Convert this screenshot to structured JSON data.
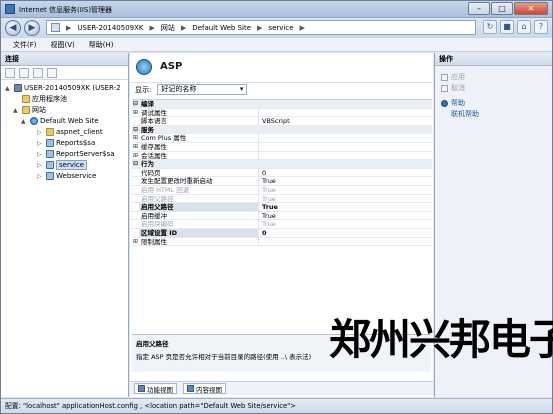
{
  "window": {
    "title": "Internet 信息服务(IIS)管理器"
  },
  "address": {
    "segments": [
      "USER-20140509XK",
      "网站",
      "Default Web Site",
      "service"
    ],
    "separator": "▶"
  },
  "menu": [
    "文件(F)",
    "视图(V)",
    "帮助(H)"
  ],
  "connections": {
    "header": "连接",
    "tree": [
      {
        "label": "USER-20140509XK (USER-2",
        "icon": "server-icon",
        "toggle": "▲"
      },
      {
        "label": "应用程序池",
        "icon": "folder-icon",
        "toggle": ""
      },
      {
        "label": "网站",
        "icon": "folder-icon",
        "toggle": "▲"
      },
      {
        "label": "Default Web Site",
        "icon": "globe-icon",
        "toggle": "▲"
      },
      {
        "label": "aspnet_client",
        "icon": "folder-icon",
        "toggle": "▷"
      },
      {
        "label": "Reports$sa",
        "icon": "app-icon",
        "toggle": "▷"
      },
      {
        "label": "ReportServer$sa",
        "icon": "app-icon",
        "toggle": "▷"
      },
      {
        "label": "service",
        "icon": "app-icon",
        "toggle": "▷",
        "selected": true
      },
      {
        "label": "Webservice",
        "icon": "app-icon",
        "toggle": "▷"
      }
    ]
  },
  "center": {
    "title": "ASP",
    "show_label": "显示:",
    "show_value": "好记的名称",
    "rows": [
      {
        "type": "cat",
        "name": "编译",
        "exp": "⊟"
      },
      {
        "type": "row",
        "name": "调试属性",
        "value": "",
        "exp": "⊞"
      },
      {
        "type": "row",
        "name": "脚本语言",
        "value": "VBScript",
        "exp": ""
      },
      {
        "type": "cat",
        "name": "服务",
        "exp": "⊟"
      },
      {
        "type": "row",
        "name": "Com Plus 属性",
        "value": "",
        "exp": "⊞"
      },
      {
        "type": "row",
        "name": "缓存属性",
        "value": "",
        "exp": "⊞"
      },
      {
        "type": "row",
        "name": "会话属性",
        "value": "",
        "exp": "⊞"
      },
      {
        "type": "cat",
        "name": "行为",
        "exp": "⊟"
      },
      {
        "type": "row",
        "name": "代码页",
        "value": "0",
        "exp": ""
      },
      {
        "type": "row",
        "name": "发生配置更改时重新启动",
        "value": "True",
        "exp": ""
      },
      {
        "type": "dim",
        "name": "启用 HTML 回退",
        "value": "True",
        "exp": ""
      },
      {
        "type": "dim",
        "name": "启用父路径",
        "value": "True",
        "exp": ""
      },
      {
        "type": "bold",
        "name": "启用父路径",
        "value": "True",
        "exp": ""
      },
      {
        "type": "row",
        "name": "启用缓冲",
        "value": "True",
        "exp": ""
      },
      {
        "type": "dim",
        "name": "启用块编码",
        "value": "True",
        "exp": ""
      },
      {
        "type": "bold",
        "name": "区域设置 ID",
        "value": "0",
        "exp": ""
      },
      {
        "type": "row",
        "name": "限制属性",
        "value": "",
        "exp": "⊞"
      }
    ],
    "description_title": "启用父路径",
    "description_text": "指定 ASP 页是否允许相对于当前目录的路径(使用 ..\\ 表示法)",
    "view_tabs": [
      "功能视图",
      "内容视图"
    ]
  },
  "actions": {
    "header": "操作",
    "items": [
      {
        "label": "应用",
        "state": "disabled"
      },
      {
        "label": "取消",
        "state": "disabled"
      },
      {
        "label": "帮助",
        "state": "link"
      },
      {
        "label": "联机帮助",
        "state": "link"
      }
    ]
  },
  "status": "配置: \"localhost\"  applicationHost.config , <location path=\"Default Web Site/service\">",
  "watermark": "郑州兴邦电子"
}
